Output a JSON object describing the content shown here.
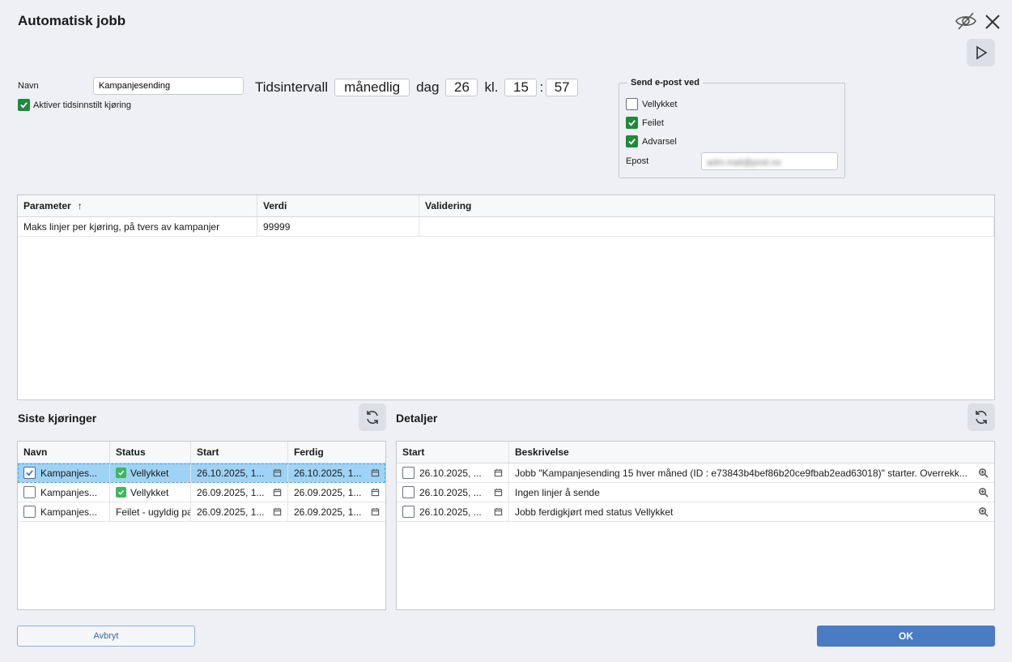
{
  "dialog": {
    "title": "Automatisk jobb"
  },
  "form": {
    "navn_label": "Navn",
    "navn_value": "Kampanjesending",
    "aktiver_label": "Aktiver tidsinnstilt kjøring",
    "aktiver_checked": true,
    "interval_label": "Tidsintervall",
    "interval_value": "månedlig",
    "dag_label": "dag",
    "dag_value": "26",
    "kl_label": "kl.",
    "hour_value": "15",
    "colon": ":",
    "minute_value": "57"
  },
  "email": {
    "legend": "Send e-post ved",
    "options": [
      {
        "label": "Vellykket",
        "checked": false
      },
      {
        "label": "Feilet",
        "checked": true
      },
      {
        "label": "Advarsel",
        "checked": true
      }
    ],
    "epost_label": "Epost",
    "epost_value": "adm.mail@post.no"
  },
  "params": {
    "columns": [
      "Parameter",
      "Verdi",
      "Validering"
    ],
    "sort_indicator": "↑",
    "rows": [
      {
        "parameter": "Maks linjer per kjøring, på tvers av kampanjer",
        "verdi": "99999",
        "validering": ""
      }
    ]
  },
  "runs": {
    "title": "Siste kjøringer",
    "columns": [
      "Navn",
      "Status",
      "Start",
      "Ferdig"
    ],
    "rows": [
      {
        "navn": "Kampanjes...",
        "status": "Vellykket",
        "status_ok": true,
        "start": "26.10.2025, 1...",
        "ferdig": "26.10.2025, 1...",
        "selected": true
      },
      {
        "navn": "Kampanjes...",
        "status": "Vellykket",
        "status_ok": true,
        "start": "26.09.2025, 1...",
        "ferdig": "26.09.2025, 1...",
        "selected": false
      },
      {
        "navn": "Kampanjes...",
        "status": "Feilet - ugyldig pa",
        "status_ok": false,
        "start": "26.09.2025, 1...",
        "ferdig": "26.09.2025, 1...",
        "selected": false
      }
    ]
  },
  "details": {
    "title": "Detaljer",
    "columns": [
      "Start",
      "Beskrivelse"
    ],
    "rows": [
      {
        "start": "26.10.2025, ...",
        "beskrivelse": "Jobb \"Kampanjesending 15 hver måned (ID : e73843b4bef86b20ce9fbab2ead63018)\" starter. Overrekk..."
      },
      {
        "start": "26.10.2025, ...",
        "beskrivelse": "Ingen linjer å sende"
      },
      {
        "start": "26.10.2025, ...",
        "beskrivelse": "Jobb ferdigkjørt med status Vellykket"
      }
    ]
  },
  "buttons": {
    "cancel": "Avbryt",
    "ok": "OK"
  },
  "colors": {
    "accent": "#4a7cc4",
    "check_green": "#1e8a3a",
    "status_green": "#3bb85c",
    "selection": "#9ed3f5"
  }
}
